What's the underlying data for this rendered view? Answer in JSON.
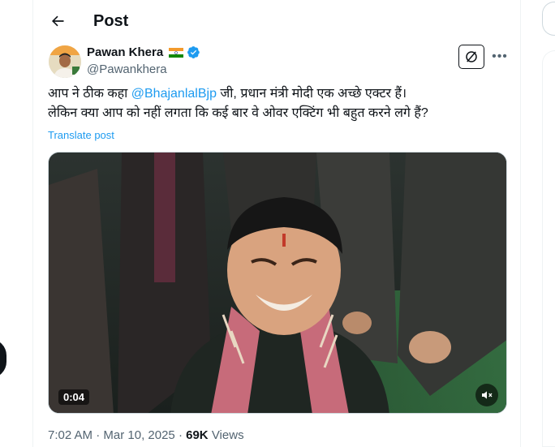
{
  "header": {
    "title": "Post"
  },
  "author": {
    "name": "Pawan Khera",
    "handle": "@Pawankhera"
  },
  "tweet": {
    "line1_prefix": "आप ने ठीक कहा ",
    "mention": "@BhajanlalBjp",
    "line1_suffix": " जी, प्रधान मंत्री मोदी एक अच्छे एक्टर हैं।",
    "line2": "लेकिन क्या आप को नहीं लगता कि कई बार वे ओवर एक्टिंग भी बहुत करने लगे हैं?",
    "translate_label": "Translate post"
  },
  "video": {
    "timer": "0:04"
  },
  "meta": {
    "time": "7:02 AM",
    "separator": " · ",
    "date": "Mar 10, 2025",
    "views_count": "69K",
    "views_label": " Views"
  },
  "icons": {
    "back": "arrow-left-icon",
    "flag": "india-flag-icon",
    "verified": "verified-badge-icon",
    "grok": "grok-icon",
    "more": "more-icon",
    "mute": "mute-icon"
  },
  "colors": {
    "accent": "#1d9bf0",
    "text": "#0f1419",
    "secondary": "#536471"
  }
}
